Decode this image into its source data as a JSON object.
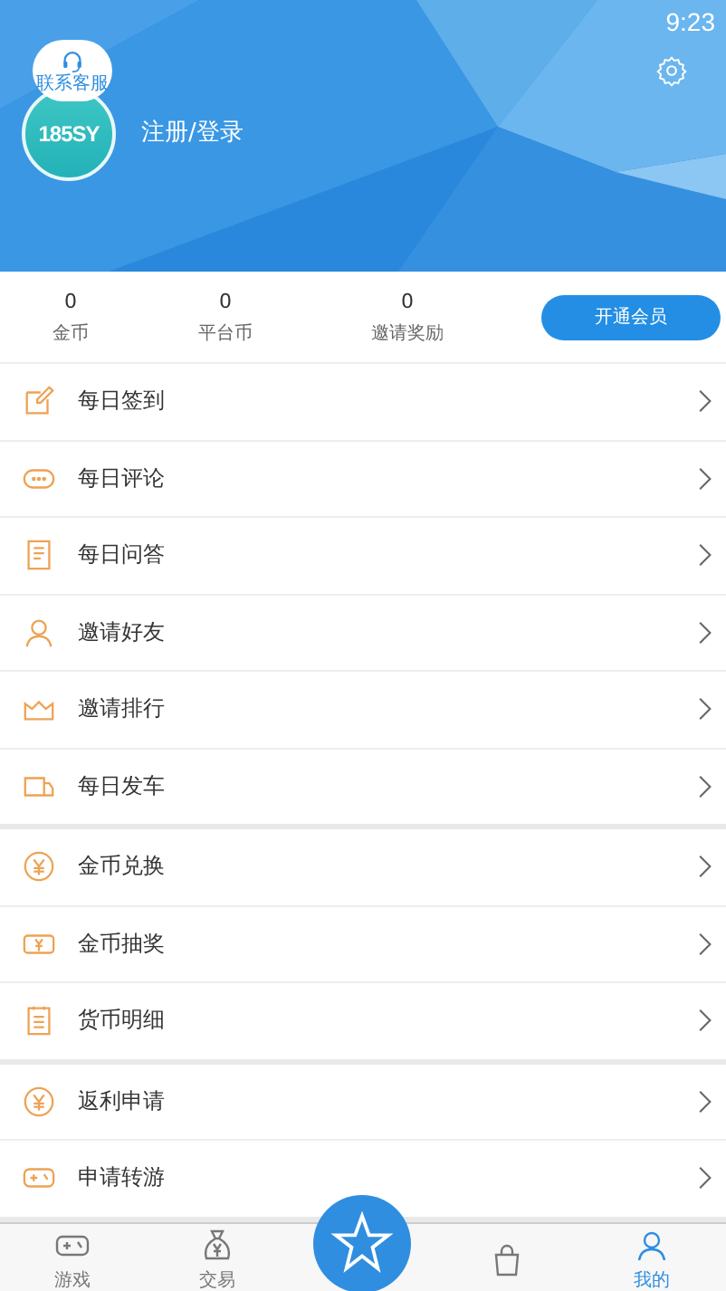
{
  "status_bar": {
    "time": "9:23"
  },
  "profile": {
    "service_badge": "联系客服",
    "avatar_logo": "185SY",
    "login": "注册/登录"
  },
  "stats": [
    {
      "value": "0",
      "label": "金币"
    },
    {
      "value": "0",
      "label": "平台币"
    },
    {
      "value": "0",
      "label": "邀请奖励"
    }
  ],
  "vip_button": "开通会员",
  "menu_sections": [
    {
      "items": [
        {
          "label": "每日签到"
        },
        {
          "label": "每日评论"
        },
        {
          "label": "每日问答"
        },
        {
          "label": "邀请好友"
        },
        {
          "label": "邀请排行"
        },
        {
          "label": "每日发车"
        }
      ]
    },
    {
      "items": [
        {
          "label": "金币兑换"
        },
        {
          "label": "金币抽奖"
        },
        {
          "label": "货币明细"
        }
      ]
    },
    {
      "items": [
        {
          "label": "返利申请"
        },
        {
          "label": "申请转游"
        }
      ]
    }
  ],
  "bottom_nav": [
    {
      "kind": "tab",
      "label": "游戏",
      "selected": false
    },
    {
      "kind": "tab",
      "label": "交易",
      "selected": false
    },
    {
      "kind": "center",
      "selected": false
    },
    {
      "kind": "tab",
      "selected": false
    },
    {
      "kind": "tab",
      "label": "我的",
      "selected": true
    }
  ]
}
